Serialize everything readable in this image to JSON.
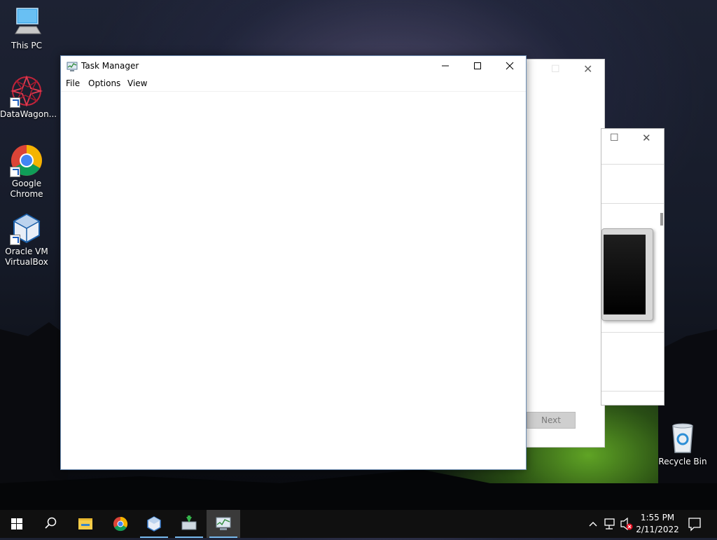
{
  "desktop": {
    "icons": [
      {
        "label": "This PC"
      },
      {
        "label": "DataWagon..."
      },
      {
        "label": "Google Chrome"
      },
      {
        "label": "Oracle VM VirtualBox"
      },
      {
        "label": "Recycle Bin"
      }
    ]
  },
  "task_manager": {
    "title": "Task Manager",
    "menu": [
      "File",
      "Options",
      "View"
    ]
  },
  "background_window": {
    "next_label": "Next"
  },
  "taskbar": {
    "time": "1:55 PM",
    "date": "2/11/2022"
  },
  "colors": {
    "accent": "#76b9ed",
    "taskbar": "#101010"
  }
}
